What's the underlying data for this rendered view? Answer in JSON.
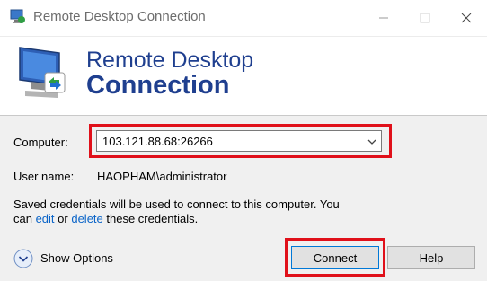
{
  "window": {
    "title": "Remote Desktop Connection",
    "icons": {
      "app": "remote-desktop-icon",
      "minimize": "minimize-icon",
      "maximize": "maximize-icon",
      "close": "close-icon"
    }
  },
  "banner": {
    "line1": "Remote Desktop",
    "line2": "Connection",
    "icon": "remote-desktop-monitor-icon",
    "title_color": "#1f3f8f"
  },
  "form": {
    "computer_label": "Computer:",
    "computer_value": "103.121.88.68:26266",
    "username_label": "User name:",
    "username_value": "HAOPHAM\\administrator",
    "note_line1": "Saved credentials will be used to connect to this computer.  You",
    "note_can": "can ",
    "note_edit": "edit",
    "note_or": " or ",
    "note_delete": "delete",
    "note_tail": " these credentials."
  },
  "footer": {
    "show_options": "Show Options",
    "connect": "Connect",
    "help": "Help"
  },
  "colors": {
    "highlight": "#e0101a",
    "link": "#0a64c8",
    "accent": "#0078d7"
  }
}
